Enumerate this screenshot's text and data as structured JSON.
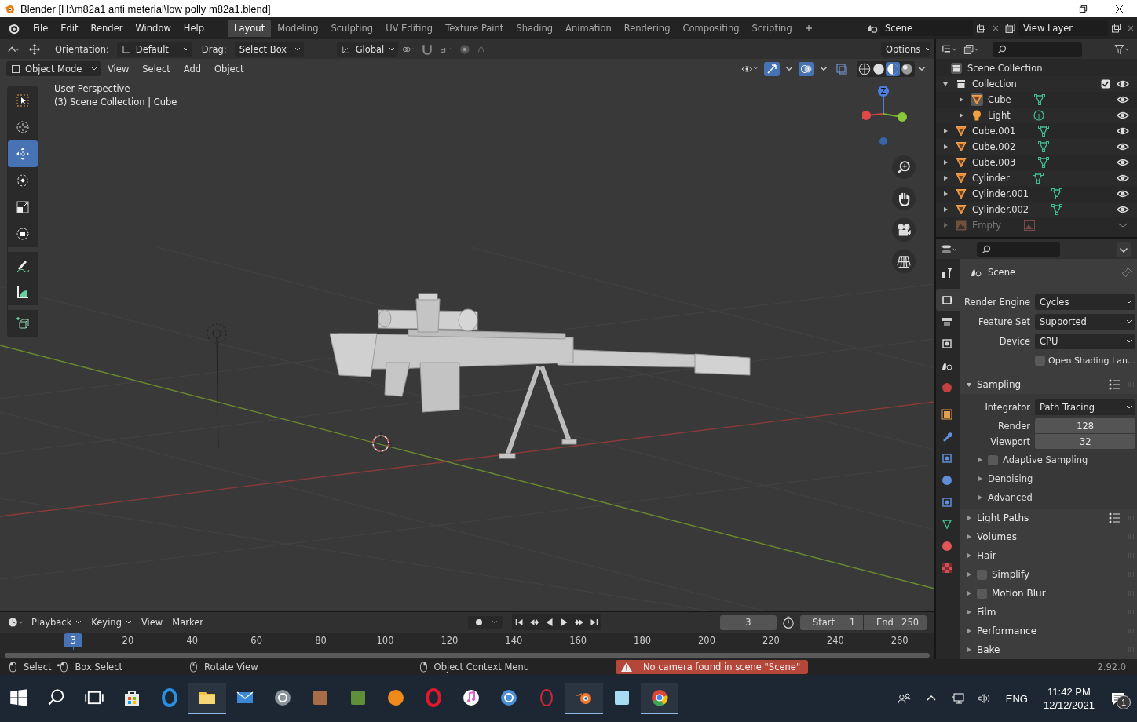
{
  "window": {
    "title": "Blender [H:\\m82a1 anti meterial\\low polly m82a1.blend]"
  },
  "menu": [
    "File",
    "Edit",
    "Render",
    "Window",
    "Help"
  ],
  "workspaces": [
    {
      "label": "Layout",
      "selected": true
    },
    {
      "label": "Modeling",
      "selected": false
    },
    {
      "label": "Sculpting",
      "selected": false
    },
    {
      "label": "UV Editing",
      "selected": false
    },
    {
      "label": "Texture Paint",
      "selected": false
    },
    {
      "label": "Shading",
      "selected": false
    },
    {
      "label": "Animation",
      "selected": false
    },
    {
      "label": "Rendering",
      "selected": false
    },
    {
      "label": "Compositing",
      "selected": false
    },
    {
      "label": "Scripting",
      "selected": false
    }
  ],
  "scene": "Scene",
  "view_layer": "View Layer",
  "tool_header": {
    "orientation_label": "Orientation:",
    "orientation": "Default",
    "drag_label": "Drag:",
    "drag": "Select Box",
    "transform": "Global",
    "options": "Options"
  },
  "viewport_header": {
    "mode": "Object Mode",
    "menus": [
      "View",
      "Select",
      "Add",
      "Object"
    ]
  },
  "viewport": {
    "lines": [
      "User Perspective",
      "(3) Scene Collection | Cube"
    ],
    "gizmo_axis": "Z"
  },
  "tools": [
    {
      "kind": "select",
      "selected": false
    },
    {
      "kind": "cursor",
      "selected": false
    },
    {
      "kind": "move",
      "selected": true
    },
    {
      "kind": "rotate",
      "selected": false
    },
    {
      "kind": "scale",
      "selected": false
    },
    {
      "kind": "transform",
      "selected": false
    },
    {
      "kind": "annotate",
      "selected": false
    },
    {
      "kind": "measure",
      "selected": false
    },
    {
      "kind": "add_cube",
      "selected": false
    }
  ],
  "outliner": {
    "root": "Scene Collection",
    "items": [
      {
        "name": "Collection",
        "kind": "collection",
        "expanded": true,
        "checked": true,
        "selected": false,
        "disabled": false,
        "children": [
          {
            "name": "Cube",
            "kind": "mesh",
            "expanded": false,
            "selected": true,
            "disabled": false
          },
          {
            "name": "Light",
            "kind": "light",
            "expanded": false,
            "selected": false,
            "disabled": false
          }
        ]
      },
      {
        "name": "Cube.001",
        "kind": "mesh",
        "expanded": false,
        "selected": false,
        "disabled": false
      },
      {
        "name": "Cube.002",
        "kind": "mesh",
        "expanded": false,
        "selected": false,
        "disabled": false
      },
      {
        "name": "Cube.003",
        "kind": "mesh",
        "expanded": false,
        "selected": false,
        "disabled": false
      },
      {
        "name": "Cylinder",
        "kind": "mesh",
        "expanded": false,
        "selected": false,
        "disabled": false
      },
      {
        "name": "Cylinder.001",
        "kind": "mesh",
        "expanded": false,
        "selected": false,
        "disabled": false
      },
      {
        "name": "Cylinder.002",
        "kind": "mesh",
        "expanded": false,
        "selected": false,
        "disabled": false
      },
      {
        "name": "Empty",
        "kind": "image",
        "expanded": false,
        "selected": false,
        "disabled": true
      }
    ]
  },
  "properties": {
    "tabs": [
      {
        "kind": "tool",
        "selected": false
      },
      {
        "kind": "render",
        "selected": true
      },
      {
        "kind": "output",
        "selected": false
      },
      {
        "kind": "view_layer",
        "selected": false
      },
      {
        "kind": "scene",
        "selected": false
      },
      {
        "kind": "world",
        "selected": false
      },
      {
        "kind": "object",
        "selected": false
      },
      {
        "kind": "modifier",
        "selected": false
      },
      {
        "kind": "particles",
        "selected": false
      },
      {
        "kind": "physics",
        "selected": false
      },
      {
        "kind": "constraints",
        "selected": false
      },
      {
        "kind": "data",
        "selected": false
      },
      {
        "kind": "material",
        "selected": false
      },
      {
        "kind": "texture",
        "selected": false
      }
    ],
    "context": "Scene",
    "fields": [
      {
        "label": "Render Engine",
        "value": "Cycles"
      },
      {
        "label": "Feature Set",
        "value": "Supported"
      },
      {
        "label": "Device",
        "value": "CPU"
      }
    ],
    "open_shading": {
      "label": "Open Shading Lan...",
      "checked": false
    },
    "sampling": {
      "title": "Sampling",
      "expanded": true,
      "integrator_label": "Integrator",
      "integrator": "Path Tracing",
      "samples": [
        {
          "label": "Render",
          "value": "128"
        },
        {
          "label": "Viewport",
          "value": "32"
        }
      ],
      "subpanels": [
        {
          "title": "Adaptive Sampling",
          "kind": "checkbox",
          "checked": false
        },
        {
          "title": "Denoising",
          "kind": "plain"
        },
        {
          "title": "Advanced",
          "kind": "plain"
        }
      ]
    },
    "panels": [
      {
        "title": "Light Paths",
        "kind": "presets"
      },
      {
        "title": "Volumes",
        "kind": "plain"
      },
      {
        "title": "Hair",
        "kind": "plain"
      },
      {
        "title": "Simplify",
        "kind": "checkbox",
        "checked": false
      },
      {
        "title": "Motion Blur",
        "kind": "checkbox",
        "checked": false
      },
      {
        "title": "Film",
        "kind": "plain"
      },
      {
        "title": "Performance",
        "kind": "plain"
      },
      {
        "title": "Bake",
        "kind": "plain"
      }
    ]
  },
  "timeline": {
    "menus": [
      "Playback",
      "Keying",
      "View",
      "Marker"
    ],
    "current_frame": "3",
    "playhead": "3",
    "start_label": "Start",
    "start": "1",
    "end_label": "End",
    "end": "250",
    "ticks": [
      "20",
      "40",
      "60",
      "80",
      "100",
      "120",
      "140",
      "160",
      "180",
      "200",
      "220",
      "240",
      "260"
    ]
  },
  "status_bar": {
    "hints": [
      {
        "kind": "left",
        "label": "Select"
      },
      {
        "kind": "drag",
        "label": "Box Select"
      },
      {
        "kind": "middle",
        "label": "Rotate View"
      },
      {
        "kind": "right",
        "label": "Object Context Menu"
      }
    ],
    "warning": "No camera found in scene \"Scene\"",
    "version": "2.92.0"
  },
  "taskbar": {
    "apps": [
      {
        "kind": "store",
        "running": false
      },
      {
        "kind": "edge",
        "running": false
      },
      {
        "kind": "explorer",
        "running": true
      },
      {
        "kind": "mail",
        "running": false
      },
      {
        "kind": "disc",
        "running": false
      },
      {
        "kind": "box",
        "running": false
      },
      {
        "kind": "block",
        "running": false
      },
      {
        "kind": "fruit",
        "running": false
      },
      {
        "kind": "opera",
        "running": false
      },
      {
        "kind": "music",
        "running": false
      },
      {
        "kind": "compass",
        "running": false
      },
      {
        "kind": "ring",
        "running": false
      },
      {
        "kind": "blender",
        "running": true
      },
      {
        "kind": "notepad",
        "running": false
      },
      {
        "kind": "chrome",
        "running": true
      }
    ],
    "language": "ENG",
    "time": "11:42 PM",
    "date": "12/12/2021",
    "notifications": "1"
  }
}
